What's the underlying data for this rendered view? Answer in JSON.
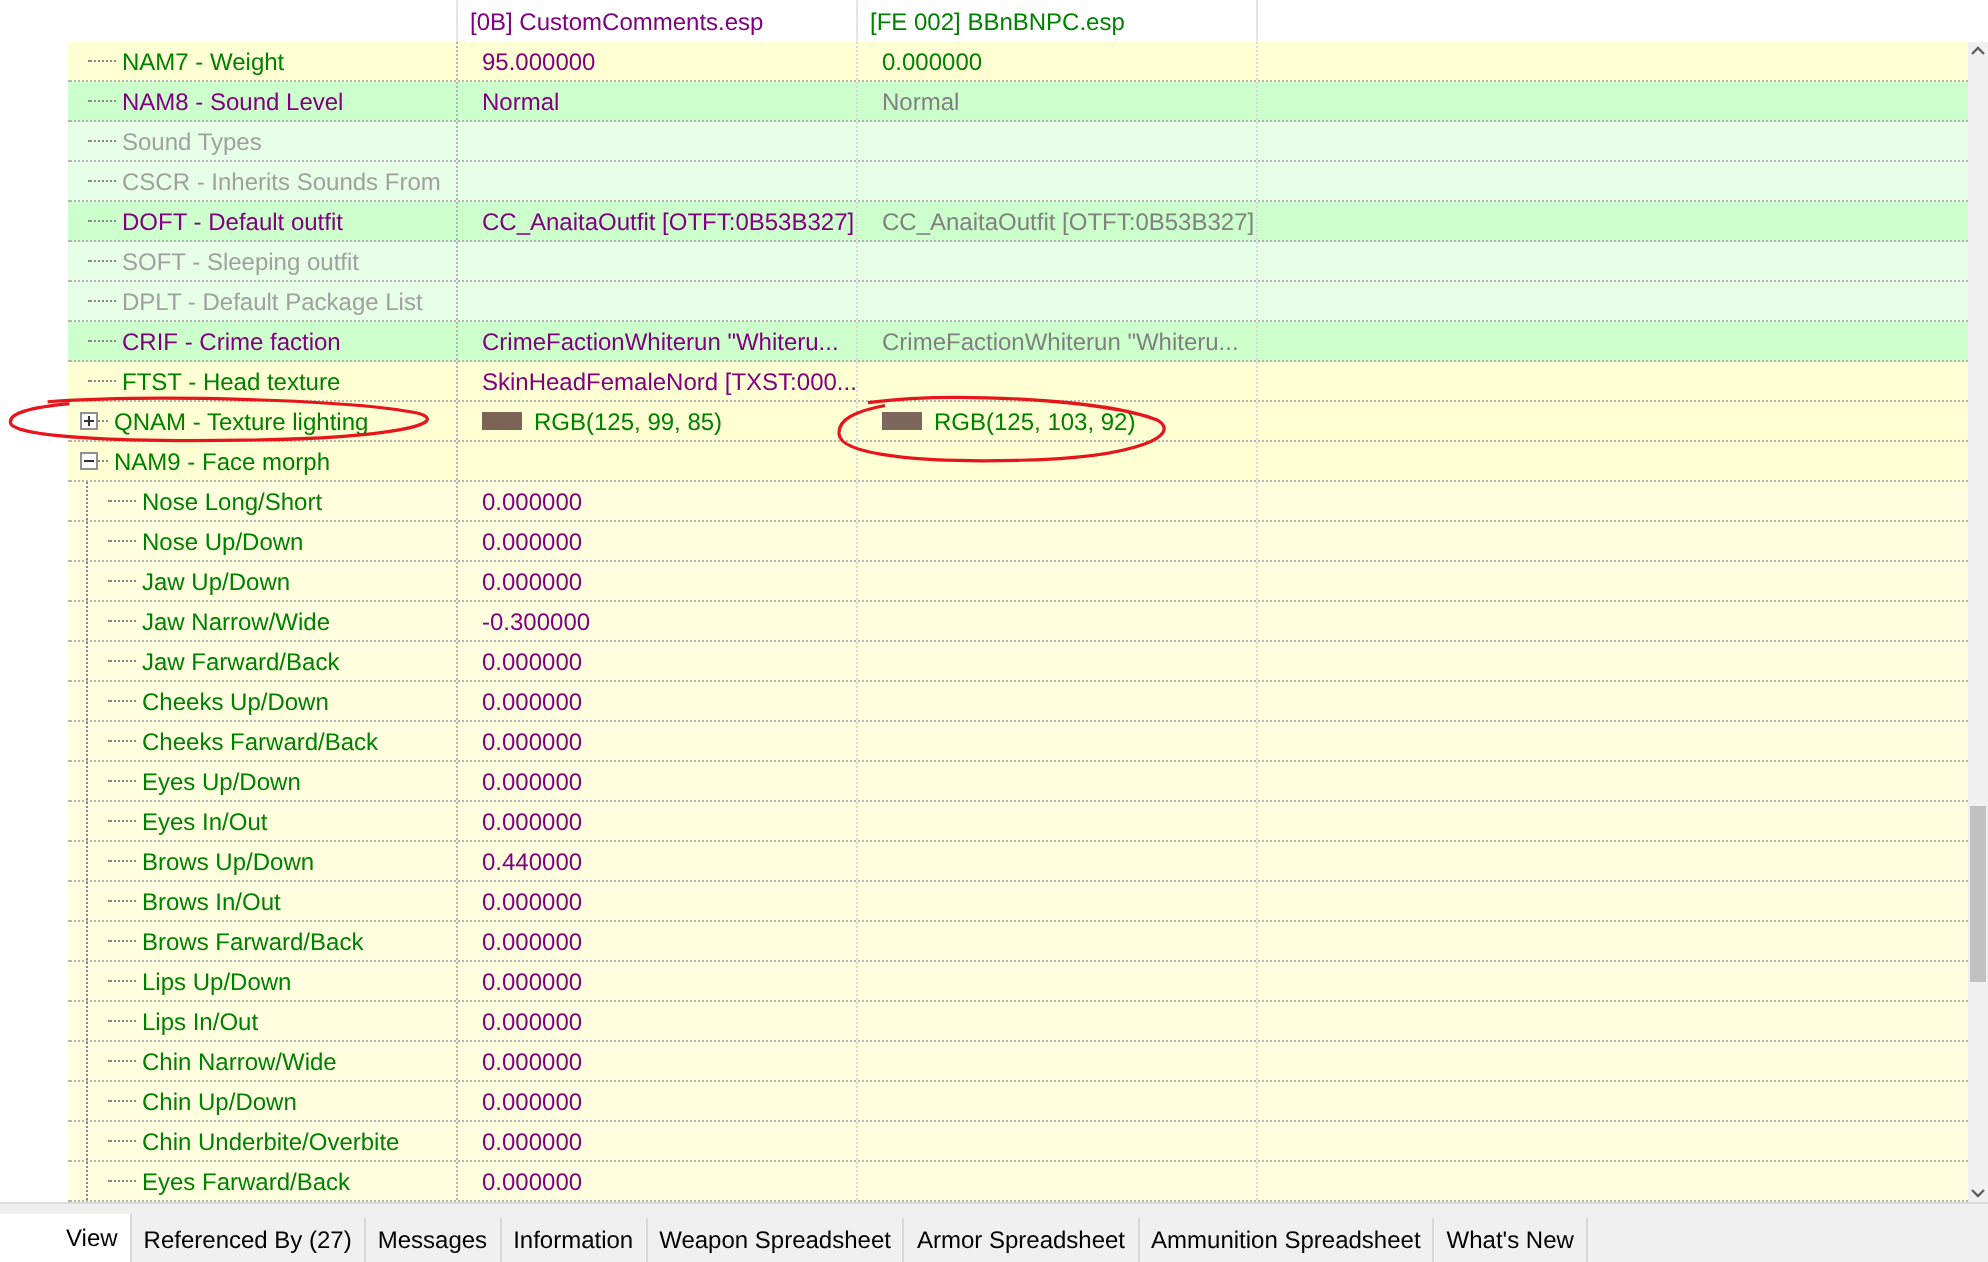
{
  "columns": [
    {
      "text": "[0B] CustomComments.esp",
      "color": "#800080"
    },
    {
      "text": "[FE 002] BBnBNPC.esp",
      "color": "#008000"
    }
  ],
  "rows": [
    {
      "label": {
        "text": "NAM7 - Weight",
        "color": "#008000"
      },
      "color": "#ffffd4",
      "value_1": {
        "text": "95.000000",
        "color": "#800080"
      },
      "value_2": {
        "text": "0.000000",
        "color": "#008000"
      }
    },
    {
      "label": {
        "text": "NAM8 - Sound Level",
        "color": "#800080"
      },
      "color": "#ccffcc",
      "value_1": {
        "text": "Normal",
        "color": "#800080"
      },
      "value_2": {
        "text": "Normal",
        "color": "#808080"
      }
    },
    {
      "label": {
        "text": "Sound Types",
        "color": "#a0a0a0"
      },
      "color": "#e6ffe6"
    },
    {
      "label": {
        "text": "CSCR - Inherits Sounds From",
        "color": "#a0a0a0"
      },
      "color": "#e6ffe6"
    },
    {
      "label": {
        "text": "DOFT - Default outfit",
        "color": "#800080"
      },
      "color": "#ccffcc",
      "value_1": {
        "text": "CC_AnaitaOutfit [OTFT:0B53B327]",
        "color": "#800080"
      },
      "value_2": {
        "text": "CC_AnaitaOutfit [OTFT:0B53B327]",
        "color": "#808080"
      }
    },
    {
      "label": {
        "text": "SOFT - Sleeping outfit",
        "color": "#a0a0a0"
      },
      "color": "#e6ffe6"
    },
    {
      "label": {
        "text": "DPLT - Default Package List",
        "color": "#a0a0a0"
      },
      "color": "#e6ffe6"
    },
    {
      "label": {
        "text": "CRIF - Crime faction",
        "color": "#800080"
      },
      "color": "#ccffcc",
      "value_1": {
        "text": "CrimeFactionWhiterun \"Whiteru...",
        "color": "#800080"
      },
      "value_2": {
        "text": "CrimeFactionWhiterun \"Whiteru...",
        "color": "#808080"
      }
    },
    {
      "label": {
        "text": "FTST - Head texture",
        "color": "#008000"
      },
      "color": "#ffffd4",
      "value_1": {
        "text": "SkinHeadFemaleNord [TXST:000...",
        "color": "#800080"
      }
    },
    {
      "label": {
        "text": "QNAM - Texture lighting",
        "color": "#008000"
      },
      "color": "#ffffd4",
      "expanded": false,
      "circled": true,
      "value_1": {
        "text": "RGB(125, 99, 85)",
        "color": "#008000",
        "swatch": {
          "color": "#7d6355"
        }
      },
      "value_2": {
        "text": "RGB(125, 103, 92)",
        "color": "#008000",
        "swatch": {
          "color": "#7d675c"
        },
        "circled": true
      }
    },
    {
      "label": {
        "text": "NAM9 - Face morph",
        "color": "#008000"
      },
      "color": "#ffffd4",
      "expanded": true,
      "children": [
        {
          "label": {
            "text": "Nose Long/Short",
            "color": "#008000"
          },
          "color": "#ffffe0",
          "value_1": {
            "text": "0.000000",
            "color": "#800080"
          }
        },
        {
          "label": {
            "text": "Nose Up/Down",
            "color": "#008000"
          },
          "color": "#ffffe0",
          "value_1": {
            "text": "0.000000",
            "color": "#800080"
          }
        },
        {
          "label": {
            "text": "Jaw Up/Down",
            "color": "#008000"
          },
          "color": "#ffffe0",
          "value_1": {
            "text": "0.000000",
            "color": "#800080"
          }
        },
        {
          "label": {
            "text": "Jaw Narrow/Wide",
            "color": "#008000"
          },
          "color": "#ffffe0",
          "value_1": {
            "text": "-0.300000",
            "color": "#800080"
          }
        },
        {
          "label": {
            "text": "Jaw Farward/Back",
            "color": "#008000"
          },
          "color": "#ffffe0",
          "value_1": {
            "text": "0.000000",
            "color": "#800080"
          }
        },
        {
          "label": {
            "text": "Cheeks Up/Down",
            "color": "#008000"
          },
          "color": "#ffffe0",
          "value_1": {
            "text": "0.000000",
            "color": "#800080"
          }
        },
        {
          "label": {
            "text": "Cheeks Farward/Back",
            "color": "#008000"
          },
          "color": "#ffffe0",
          "value_1": {
            "text": "0.000000",
            "color": "#800080"
          }
        },
        {
          "label": {
            "text": "Eyes Up/Down",
            "color": "#008000"
          },
          "color": "#ffffe0",
          "value_1": {
            "text": "0.000000",
            "color": "#800080"
          }
        },
        {
          "label": {
            "text": "Eyes In/Out",
            "color": "#008000"
          },
          "color": "#ffffe0",
          "value_1": {
            "text": "0.000000",
            "color": "#800080"
          }
        },
        {
          "label": {
            "text": "Brows Up/Down",
            "color": "#008000"
          },
          "color": "#ffffe0",
          "value_1": {
            "text": "0.440000",
            "color": "#800080"
          }
        },
        {
          "label": {
            "text": "Brows In/Out",
            "color": "#008000"
          },
          "color": "#ffffe0",
          "value_1": {
            "text": "0.000000",
            "color": "#800080"
          }
        },
        {
          "label": {
            "text": "Brows Farward/Back",
            "color": "#008000"
          },
          "color": "#ffffe0",
          "value_1": {
            "text": "0.000000",
            "color": "#800080"
          }
        },
        {
          "label": {
            "text": "Lips Up/Down",
            "color": "#008000"
          },
          "color": "#ffffe0",
          "value_1": {
            "text": "0.000000",
            "color": "#800080"
          }
        },
        {
          "label": {
            "text": "Lips In/Out",
            "color": "#008000"
          },
          "color": "#ffffe0",
          "value_1": {
            "text": "0.000000",
            "color": "#800080"
          }
        },
        {
          "label": {
            "text": "Chin Narrow/Wide",
            "color": "#008000"
          },
          "color": "#ffffe0",
          "value_1": {
            "text": "0.000000",
            "color": "#800080"
          }
        },
        {
          "label": {
            "text": "Chin Up/Down",
            "color": "#008000"
          },
          "color": "#ffffe0",
          "value_1": {
            "text": "0.000000",
            "color": "#800080"
          }
        },
        {
          "label": {
            "text": "Chin Underbite/Overbite",
            "color": "#008000"
          },
          "color": "#ffffe0",
          "value_1": {
            "text": "0.000000",
            "color": "#800080"
          }
        },
        {
          "label": {
            "text": "Eyes Farward/Back",
            "color": "#008000"
          },
          "color": "#ffffe0",
          "value_1": {
            "text": "0.000000",
            "color": "#800080"
          }
        }
      ]
    }
  ],
  "tabs": [
    {
      "label": "View",
      "selected": true
    },
    {
      "label": "Referenced By (27)",
      "selected": false
    },
    {
      "label": "Messages",
      "selected": false
    },
    {
      "label": "Information",
      "selected": false
    },
    {
      "label": "Weapon Spreadsheet",
      "selected": false
    },
    {
      "label": "Armor Spreadsheet",
      "selected": false
    },
    {
      "label": "Ammunition Spreadsheet",
      "selected": false
    },
    {
      "label": "What's New",
      "selected": false
    }
  ]
}
